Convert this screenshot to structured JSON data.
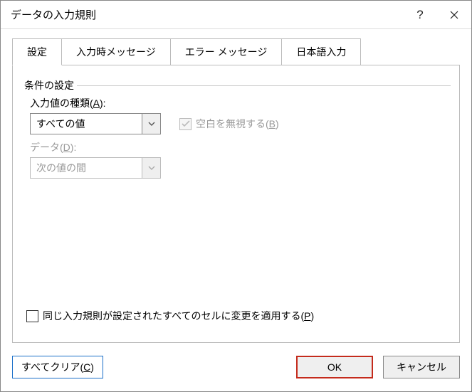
{
  "title": "データの入力規則",
  "tabs": {
    "t0": "設定",
    "t1": "入力時メッセージ",
    "t2": "エラー メッセージ",
    "t3": "日本語入力"
  },
  "fieldset": "条件の設定",
  "allow_label_pre": "入力値の種類(",
  "allow_label_key": "A",
  "allow_label_post": "):",
  "allow_value": "すべての値",
  "ignore_blank_pre": "空白を無視する(",
  "ignore_blank_key": "B",
  "ignore_blank_post": ")",
  "data_label_pre": "データ(",
  "data_label_key": "D",
  "data_label_post": "):",
  "data_value": "次の値の間",
  "apply_all_pre": "同じ入力規則が設定されたすべてのセルに変更を適用する(",
  "apply_all_key": "P",
  "apply_all_post": ")",
  "clear_pre": "すべてクリア(",
  "clear_key": "C",
  "clear_post": ")",
  "ok": "OK",
  "cancel": "キャンセル"
}
